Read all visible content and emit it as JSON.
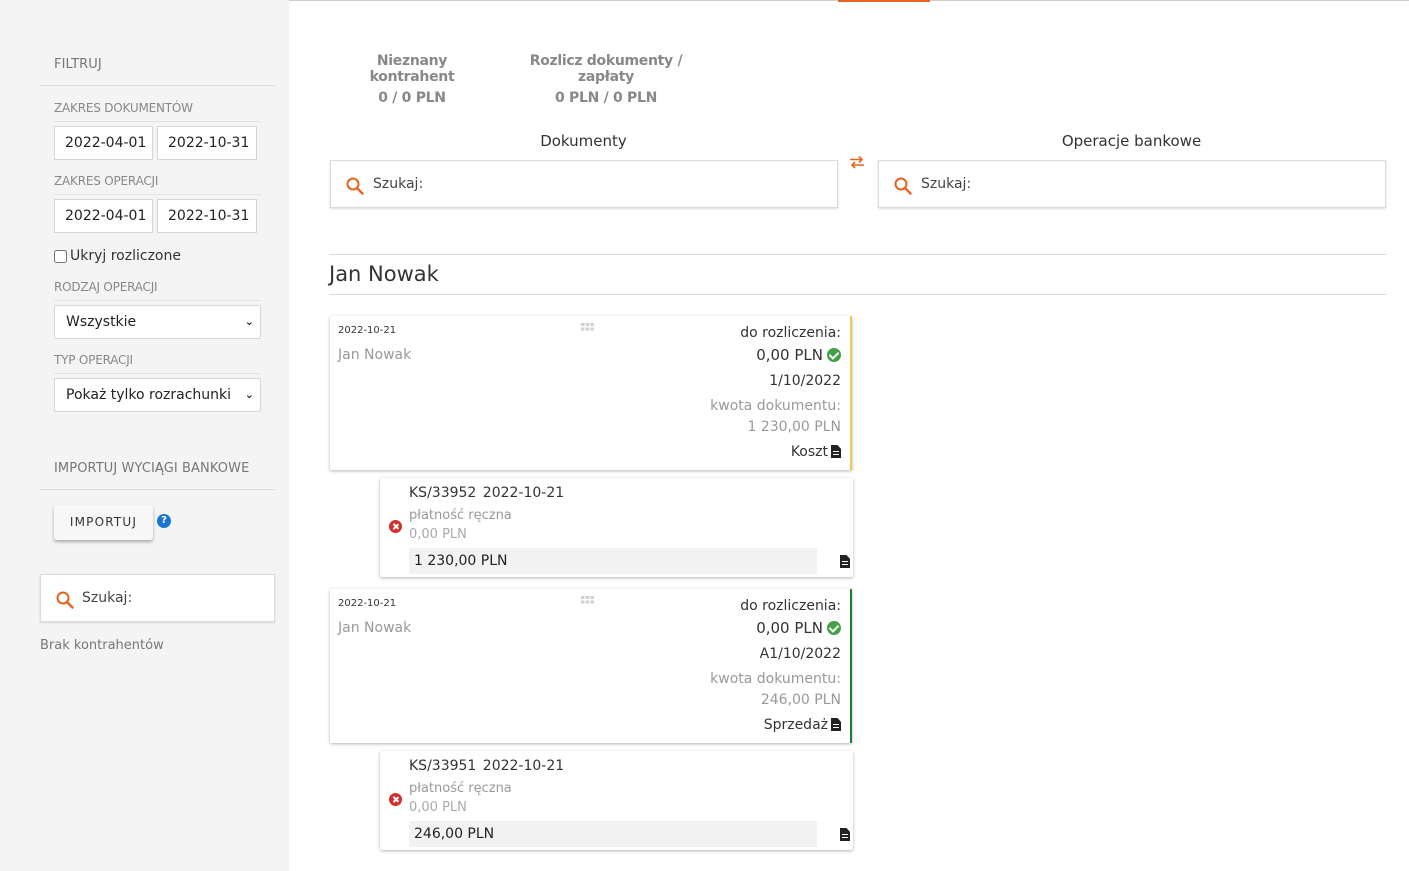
{
  "sidebar": {
    "filter_title": "FILTRUJ",
    "doc_range_label": "ZAKRES DOKUMENTÓW",
    "doc_range_from": "2022-04-01",
    "doc_range_to": "2022-10-31",
    "op_range_label": "ZAKRES OPERACJI",
    "op_range_from": "2022-04-01",
    "op_range_to": "2022-10-31",
    "hide_settled_label": "Ukryj rozliczone",
    "op_kind_label": "RODZAJ OPERACJI",
    "op_kind_value": "Wszystkie",
    "op_type_label": "TYP OPERACJI",
    "op_type_value": "Pokaż tylko rozrachunki",
    "import_title": "IMPORTUJ WYCIĄGI BANKOWE",
    "import_button": "IMPORTUJ",
    "help_symbol": "?",
    "search_placeholder": "Szukaj:",
    "no_contractors": "Brak kontrahentów"
  },
  "stats": {
    "unknown_label": "Nieznany kontrahent",
    "unknown_value": "0 / 0 PLN",
    "settle_label": "Rozlicz dokumenty / zapłaty",
    "settle_value": "0 PLN / 0 PLN"
  },
  "columns": {
    "documents_title": "Dokumenty",
    "documents_search": "Szukaj:",
    "bank_title": "Operacje bankowe",
    "bank_search": "Szukaj:"
  },
  "contractor": {
    "name": "Jan Nowak",
    "documents": [
      {
        "date": "2022-10-21",
        "name": "Jan Nowak",
        "to_settle_label": "do rozliczenia:",
        "to_settle_value": "0,00 PLN",
        "number": "1/10/2022",
        "amount_label": "kwota dokumentu:",
        "amount_value": "1 230,00 PLN",
        "kind": "Koszt",
        "bar_color": "#f2c94c",
        "payment": {
          "number": "KS/33952",
          "date": "2022-10-21",
          "type": "płatność ręczna",
          "small_amount": "0,00 PLN",
          "amount": "1 230,00 PLN"
        }
      },
      {
        "date": "2022-10-21",
        "name": "Jan Nowak",
        "to_settle_label": "do rozliczenia:",
        "to_settle_value": "0,00 PLN",
        "number": "A1/10/2022",
        "amount_label": "kwota dokumentu:",
        "amount_value": "246,00 PLN",
        "kind": "Sprzedaż",
        "bar_color": "#1e7e34",
        "payment": {
          "number": "KS/33951",
          "date": "2022-10-21",
          "type": "płatność ręczna",
          "small_amount": "0,00 PLN",
          "amount": "246,00 PLN"
        }
      }
    ]
  },
  "colors": {
    "accent": "#e8631c",
    "success": "#43a047",
    "error": "#d32f2f",
    "help": "#1976d2"
  }
}
